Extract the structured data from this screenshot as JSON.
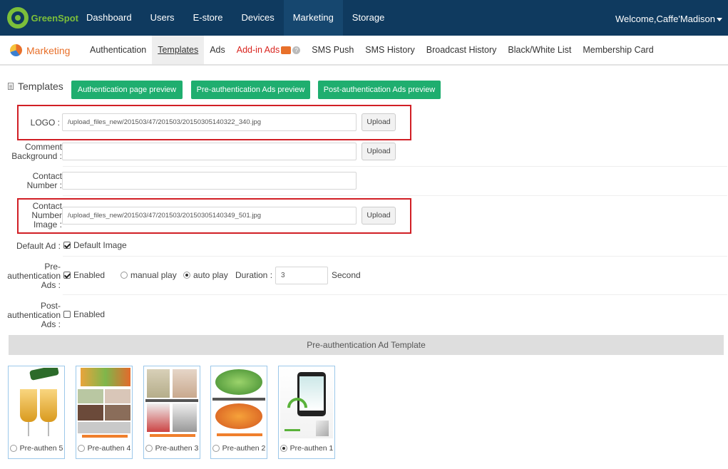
{
  "brand": {
    "name": "GreenSpot"
  },
  "topnav": {
    "items": [
      "Dashboard",
      "Users",
      "E-store",
      "Devices",
      "Marketing",
      "Storage"
    ],
    "welcome": "Welcome,Caffe'Madison"
  },
  "subnav": {
    "title": "Marketing",
    "items": [
      "Authentication",
      "Templates",
      "Ads",
      "Add-in Ads",
      "SMS Push",
      "SMS History",
      "Broadcast History",
      "Black/White List",
      "Membership Card"
    ]
  },
  "templates": {
    "title": "Templates",
    "btn_auth_preview": "Authentication page preview",
    "btn_pre_preview": "Pre-authentication Ads preview",
    "btn_post_preview": "Post-authentication Ads preview"
  },
  "form": {
    "logo_label": "LOGO :",
    "logo_value": "/upload_files_new/201503/47/201503/20150305140322_340.jpg",
    "comment_bg_label_1": "Comment",
    "comment_bg_label_2": "Background :",
    "comment_bg_value": "",
    "contact_number_label_1": "Contact",
    "contact_number_label_2": "Number :",
    "contact_number_value": "",
    "contact_image_label_1": "Contact",
    "contact_image_label_2": "Number",
    "contact_image_label_3": "Image :",
    "contact_image_value": "/upload_files_new/201503/47/201503/20150305140349_501.jpg",
    "upload_label": "Upload",
    "default_ad_label": "Default Ad :",
    "default_image_label": "Default Image",
    "pre_label_1": "Pre-",
    "pre_label_2": "authentication",
    "pre_label_3": "Ads :",
    "enabled_label": "Enabled",
    "manual_play_label": "manual play",
    "auto_play_label": "auto play",
    "duration_label": "Duration :",
    "duration_value": "3",
    "second_label": "Second",
    "post_label_1": "Post-",
    "post_label_2": "authentication",
    "post_label_3": "Ads :",
    "post_enabled_label": "Enabled"
  },
  "ad_template": {
    "title": "Pre-authentication Ad Template",
    "items": [
      "Pre-authen 5",
      "Pre-authen 4",
      "Pre-authen 3",
      "Pre-authen 2",
      "Pre-authen 1"
    ],
    "selected": "Pre-authen 1"
  },
  "colors": {
    "navbar": "#0f3a5f",
    "accent_green": "#1fae6f",
    "highlight_red": "#d11f25",
    "marketing_orange": "#e8702a"
  }
}
